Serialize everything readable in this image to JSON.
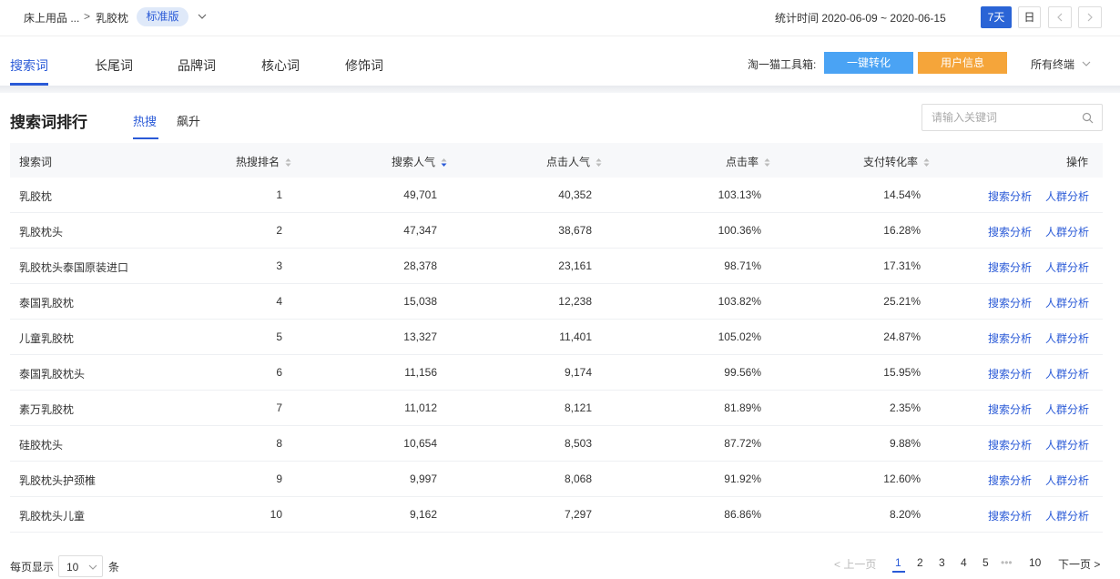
{
  "breadcrumb": {
    "category": "床上用品 ...",
    "separator": ">",
    "keyword": "乳胶枕"
  },
  "edition_badge": "标准版",
  "stat_time": "统计时间 2020-06-09 ~ 2020-06-15",
  "range_buttons": {
    "seven_days": "7天",
    "day": "日"
  },
  "tabs": [
    "搜索词",
    "长尾词",
    "品牌词",
    "核心词",
    "修饰词"
  ],
  "toolbox": {
    "label": "淘一猫工具箱:",
    "convert": "一键转化",
    "user_info": "用户信息"
  },
  "terminal": "所有终端",
  "ranking": {
    "title": "搜索词排行",
    "subtabs": [
      "热搜",
      "飙升"
    ],
    "search_placeholder": "请输入关键词"
  },
  "table": {
    "columns": [
      "搜索词",
      "热搜排名",
      "搜索人气",
      "点击人气",
      "点击率",
      "支付转化率",
      "操作"
    ],
    "actions": [
      "搜索分析",
      "人群分析"
    ],
    "rows": [
      {
        "keyword": "乳胶枕",
        "rank": "1",
        "search_pop": "49,701",
        "click_pop": "40,352",
        "ctr": "103.13%",
        "cvr": "14.54%"
      },
      {
        "keyword": "乳胶枕头",
        "rank": "2",
        "search_pop": "47,347",
        "click_pop": "38,678",
        "ctr": "100.36%",
        "cvr": "16.28%"
      },
      {
        "keyword": "乳胶枕头泰国原装进口",
        "rank": "3",
        "search_pop": "28,378",
        "click_pop": "23,161",
        "ctr": "98.71%",
        "cvr": "17.31%"
      },
      {
        "keyword": "泰国乳胶枕",
        "rank": "4",
        "search_pop": "15,038",
        "click_pop": "12,238",
        "ctr": "103.82%",
        "cvr": "25.21%"
      },
      {
        "keyword": "儿童乳胶枕",
        "rank": "5",
        "search_pop": "13,327",
        "click_pop": "11,401",
        "ctr": "105.02%",
        "cvr": "24.87%"
      },
      {
        "keyword": "泰国乳胶枕头",
        "rank": "6",
        "search_pop": "11,156",
        "click_pop": "9,174",
        "ctr": "99.56%",
        "cvr": "15.95%"
      },
      {
        "keyword": "素万乳胶枕",
        "rank": "7",
        "search_pop": "11,012",
        "click_pop": "8,121",
        "ctr": "81.89%",
        "cvr": "2.35%"
      },
      {
        "keyword": "硅胶枕头",
        "rank": "8",
        "search_pop": "10,654",
        "click_pop": "8,503",
        "ctr": "87.72%",
        "cvr": "9.88%"
      },
      {
        "keyword": "乳胶枕头护颈椎",
        "rank": "9",
        "search_pop": "9,997",
        "click_pop": "8,068",
        "ctr": "91.92%",
        "cvr": "12.60%"
      },
      {
        "keyword": "乳胶枕头儿童",
        "rank": "10",
        "search_pop": "9,162",
        "click_pop": "7,297",
        "ctr": "86.86%",
        "cvr": "8.20%"
      }
    ]
  },
  "pagination": {
    "per_page_label": "每页显示",
    "page_size": "10",
    "unit": "条",
    "prev": "< 上一页",
    "pages": [
      "1",
      "2",
      "3",
      "4",
      "5"
    ],
    "ellipsis": "•••",
    "last": "10",
    "next": "下一页 >"
  },
  "colors": {
    "accent": "#2a5ad7",
    "convert_btn": "#4aa3f4",
    "userinfo_btn": "#f5a53a"
  }
}
